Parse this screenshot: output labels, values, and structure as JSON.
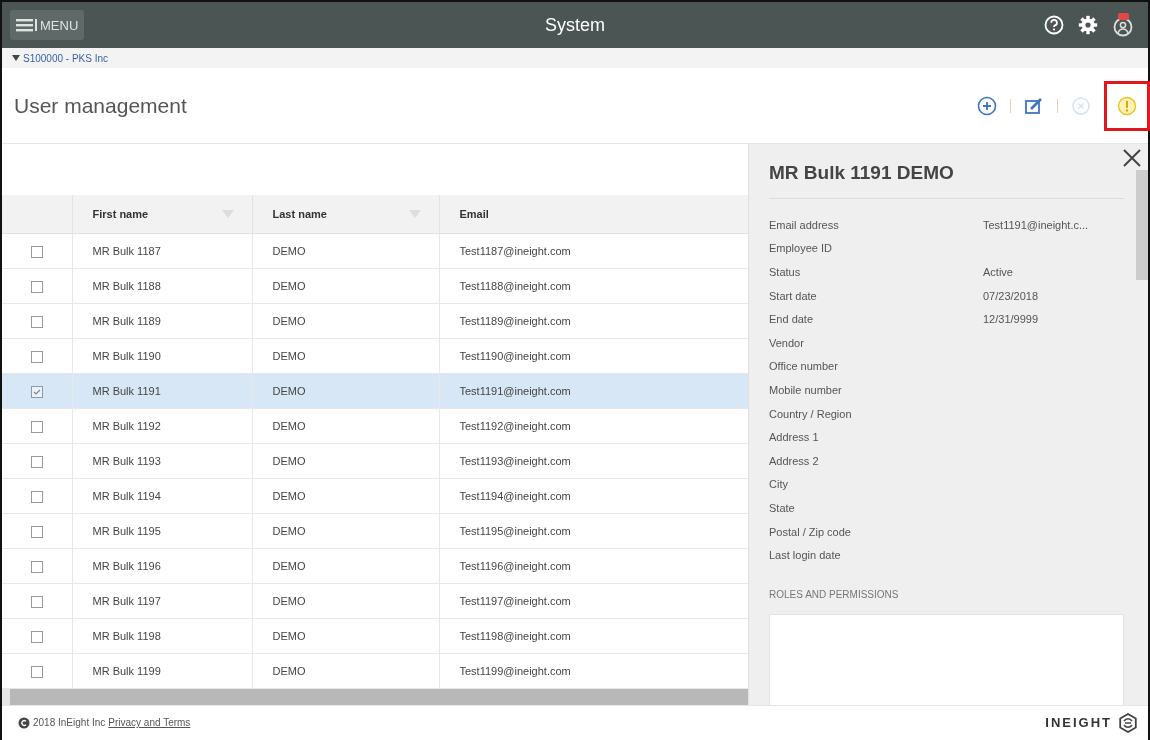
{
  "top_bar": {
    "menu_button": "MENU",
    "title": "System"
  },
  "breadcrumb": {
    "label": "S100000 - PKS Inc",
    "expanded": true
  },
  "page": {
    "title": "User management"
  },
  "toolbar": [
    {
      "kind": "add",
      "disabled": false,
      "highlighted": false
    },
    {
      "kind": "edit",
      "disabled": false,
      "highlighted": false
    },
    {
      "kind": "cancel",
      "disabled": true,
      "highlighted": false
    },
    {
      "kind": "info",
      "disabled": false,
      "highlighted": true
    }
  ],
  "table": {
    "columns": [
      {
        "label": "First name",
        "filter": true
      },
      {
        "label": "Last name",
        "filter": true
      },
      {
        "label": "Email",
        "filter": false
      }
    ],
    "rows": [
      {
        "first_name": "MR Bulk 1187",
        "last_name": "DEMO",
        "email": "Test1187@ineight.com",
        "selected": false
      },
      {
        "first_name": "MR Bulk 1188",
        "last_name": "DEMO",
        "email": "Test1188@ineight.com",
        "selected": false
      },
      {
        "first_name": "MR Bulk 1189",
        "last_name": "DEMO",
        "email": "Test1189@ineight.com",
        "selected": false
      },
      {
        "first_name": "MR Bulk 1190",
        "last_name": "DEMO",
        "email": "Test1190@ineight.com",
        "selected": false
      },
      {
        "first_name": "MR Bulk 1191",
        "last_name": "DEMO",
        "email": "Test1191@ineight.com",
        "selected": true
      },
      {
        "first_name": "MR Bulk 1192",
        "last_name": "DEMO",
        "email": "Test1192@ineight.com",
        "selected": false
      },
      {
        "first_name": "MR Bulk 1193",
        "last_name": "DEMO",
        "email": "Test1193@ineight.com",
        "selected": false
      },
      {
        "first_name": "MR Bulk 1194",
        "last_name": "DEMO",
        "email": "Test1194@ineight.com",
        "selected": false
      },
      {
        "first_name": "MR Bulk 1195",
        "last_name": "DEMO",
        "email": "Test1195@ineight.com",
        "selected": false
      },
      {
        "first_name": "MR Bulk 1196",
        "last_name": "DEMO",
        "email": "Test1196@ineight.com",
        "selected": false
      },
      {
        "first_name": "MR Bulk 1197",
        "last_name": "DEMO",
        "email": "Test1197@ineight.com",
        "selected": false
      },
      {
        "first_name": "MR Bulk 1198",
        "last_name": "DEMO",
        "email": "Test1198@ineight.com",
        "selected": false
      },
      {
        "first_name": "MR Bulk 1199",
        "last_name": "DEMO",
        "email": "Test1199@ineight.com",
        "selected": false
      }
    ]
  },
  "details": {
    "title": "MR Bulk 1191 DEMO",
    "fields": [
      {
        "label": "Email address",
        "value": "Test1191@ineight.c..."
      },
      {
        "label": "Employee ID"
      },
      {
        "label": "Status",
        "value": "Active"
      },
      {
        "label": "Start date",
        "value": "07/23/2018"
      },
      {
        "label": "End date",
        "value": "12/31/9999"
      },
      {
        "label": "Vendor"
      },
      {
        "label": "Office number"
      },
      {
        "label": "Mobile number"
      },
      {
        "label": "Country / Region"
      },
      {
        "label": "Address 1"
      },
      {
        "label": "Address 2"
      },
      {
        "label": "City"
      },
      {
        "label": "State"
      },
      {
        "label": "Postal / Zip code"
      },
      {
        "label": "Last login date"
      }
    ],
    "section": "ROLES AND PERMISSIONS"
  },
  "footer": {
    "copyright": "2018 InEight Inc",
    "link": "Privacy and Terms",
    "logo": "INEIGHT"
  }
}
